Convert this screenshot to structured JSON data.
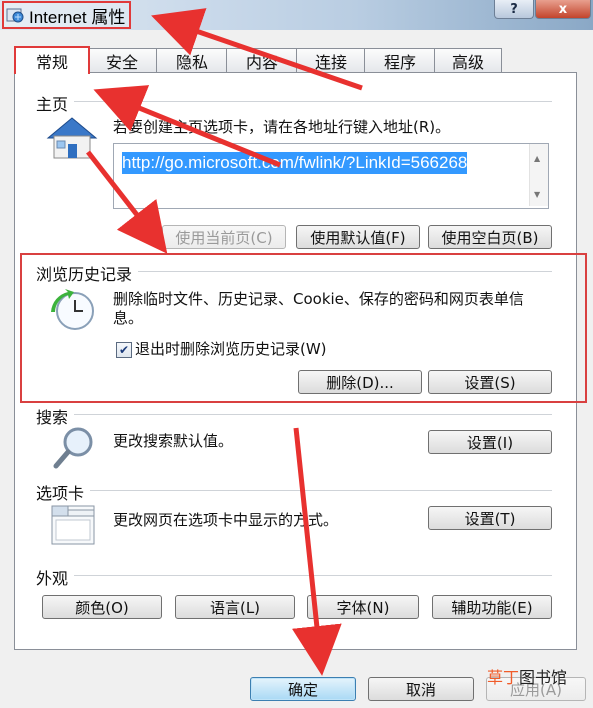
{
  "window": {
    "title": "Internet 属性",
    "help_label": "?",
    "close_label": "x"
  },
  "tabs": [
    {
      "label": "常规",
      "active": true
    },
    {
      "label": "安全"
    },
    {
      "label": "隐私"
    },
    {
      "label": "内容"
    },
    {
      "label": "连接"
    },
    {
      "label": "程序"
    },
    {
      "label": "高级"
    }
  ],
  "homepage": {
    "heading": "主页",
    "description": "若要创建主页选项卡，请在各地址行键入地址(R)。",
    "url": "http://go.microsoft.com/fwlink/?LinkId=566268",
    "btn_current": "使用当前页(C)",
    "btn_default": "使用默认值(F)",
    "btn_blank": "使用空白页(B)"
  },
  "history": {
    "heading": "浏览历史记录",
    "description": "删除临时文件、历史记录、Cookie、保存的密码和网页表单信息。",
    "checkbox_label": "退出时删除浏览历史记录(W)",
    "checked": true,
    "btn_delete": "删除(D)...",
    "btn_settings": "设置(S)"
  },
  "search": {
    "heading": "搜索",
    "description": "更改搜索默认值。",
    "btn_settings": "设置(I)"
  },
  "tabs_section": {
    "heading": "选项卡",
    "description": "更改网页在选项卡中显示的方式。",
    "btn_settings": "设置(T)"
  },
  "appearance": {
    "heading": "外观",
    "btn_colors": "颜色(O)",
    "btn_languages": "语言(L)",
    "btn_fonts": "字体(N)",
    "btn_accessibility": "辅助功能(E)"
  },
  "footer": {
    "ok": "确定",
    "cancel": "取消",
    "apply": "应用(A)"
  },
  "watermark": {
    "part1": "草",
    "part2": "丁",
    "part3": "图书馆"
  },
  "colors": {
    "annotation_red": "#e03a3a",
    "selection_blue": "#3399ff"
  }
}
